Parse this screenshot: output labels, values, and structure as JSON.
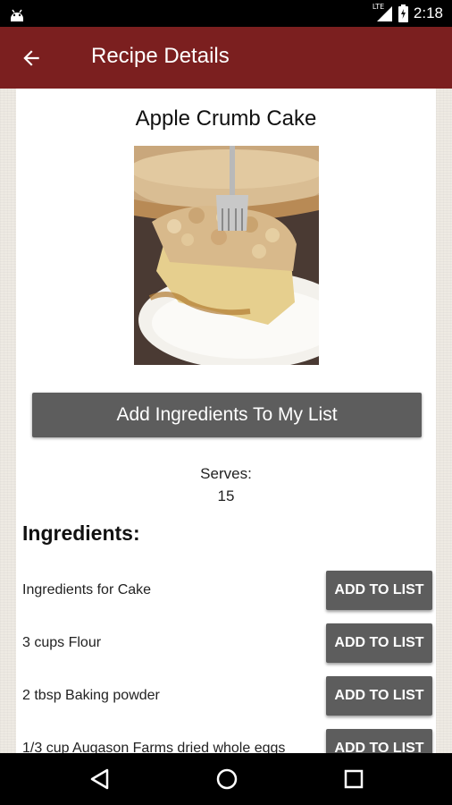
{
  "status_bar": {
    "time": "2:18",
    "network_label": "LTE",
    "icons": [
      "android-notification-icon",
      "signal-icon",
      "battery-icon"
    ]
  },
  "app_bar": {
    "title": "Recipe Details",
    "back_icon": "arrow-back-icon",
    "color": "#7b1f1f"
  },
  "recipe": {
    "title": "Apple Crumb Cake",
    "add_all_label": "Add Ingredients To My List",
    "serves_label": "Serves:",
    "serves_value": "15",
    "ingredients_heading": "Ingredients:",
    "ingredients": [
      {
        "name": "Ingredients for Cake",
        "button": "ADD TO LIST"
      },
      {
        "name": "3 cups Flour",
        "button": "ADD TO LIST"
      },
      {
        "name": "2 tbsp Baking powder",
        "button": "ADD TO LIST"
      },
      {
        "name": "1/3 cup Augason Farms dried whole eggs",
        "button": "ADD TO LIST"
      }
    ]
  },
  "nav_bar": {
    "buttons": [
      "back-triangle-icon",
      "home-circle-icon",
      "recents-square-icon"
    ]
  },
  "colors": {
    "button_gray": "#5d5d5d",
    "background": "#eeeae3"
  }
}
